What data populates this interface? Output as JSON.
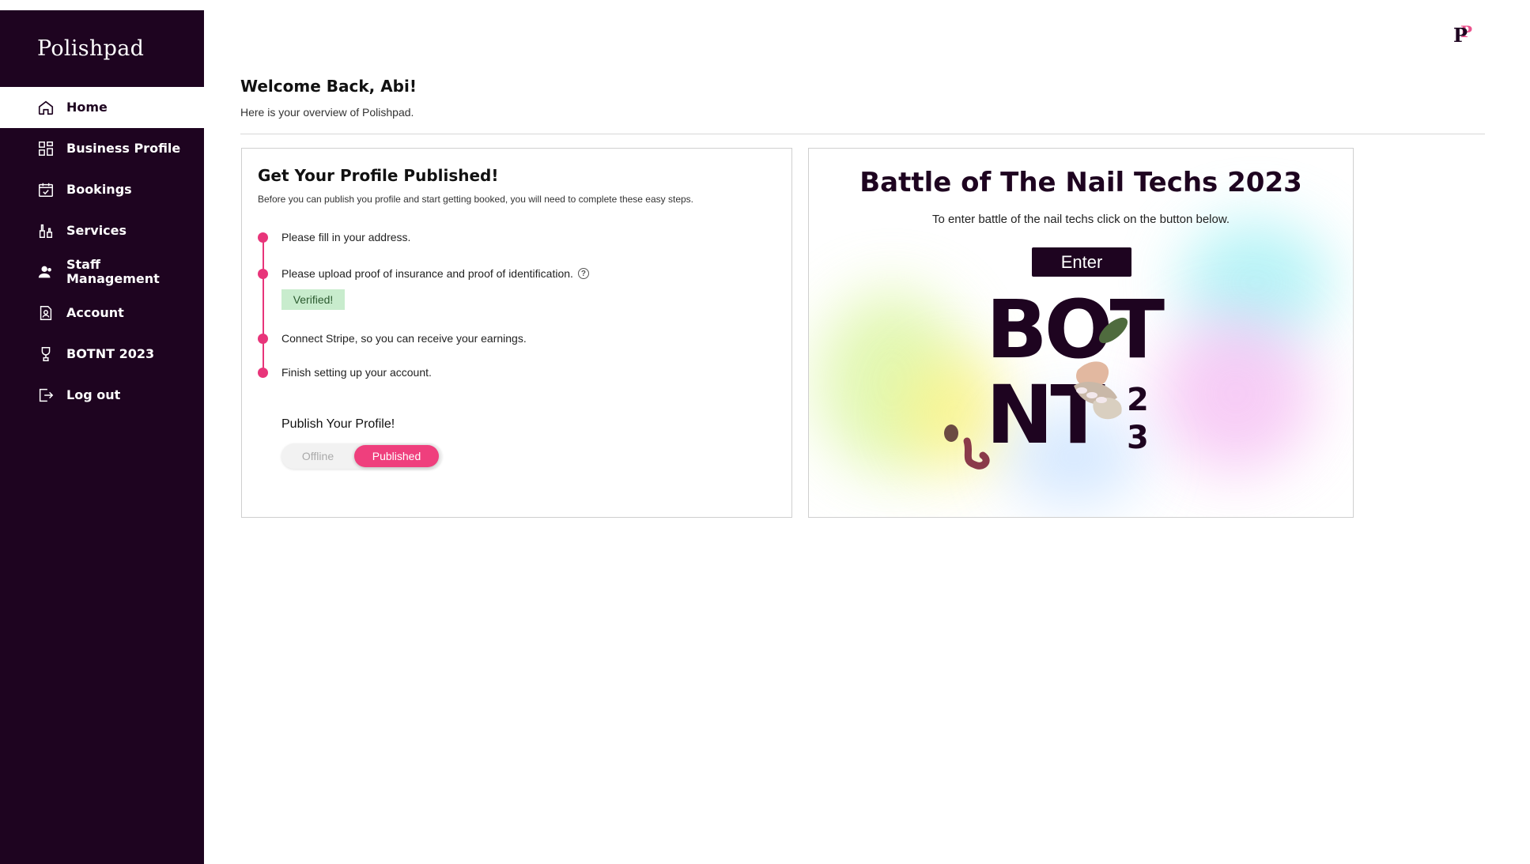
{
  "app": {
    "brand": "Polishpad"
  },
  "sidebar": {
    "items": [
      {
        "label": "Home",
        "icon": "home-icon",
        "active": true
      },
      {
        "label": "Business Profile",
        "icon": "grid-icon",
        "active": false
      },
      {
        "label": "Bookings",
        "icon": "calendar-check-icon",
        "active": false
      },
      {
        "label": "Services",
        "icon": "polish-bottles-icon",
        "active": false
      },
      {
        "label": "Staff\nManagement",
        "icon": "users-icon",
        "active": false
      },
      {
        "label": "Account",
        "icon": "account-document-icon",
        "active": false
      },
      {
        "label": "BOTNT 2023",
        "icon": "trophy-icon",
        "active": false
      },
      {
        "label": "Log out",
        "icon": "logout-icon",
        "active": false
      }
    ]
  },
  "header": {
    "welcome": "Welcome Back, Abi!",
    "subtitle": "Here is your overview of Polishpad."
  },
  "profile_card": {
    "title": "Get Your Profile Published!",
    "description": "Before you can publish you profile and start getting booked, you will need to complete these easy steps.",
    "steps": [
      "Please fill in your address.",
      "Please upload proof of insurance and proof of identification.",
      "Connect Stripe, so you can receive your earnings.",
      "Finish setting up your account."
    ],
    "verified_badge": "Verified!",
    "publish_label": "Publish Your Profile!",
    "toggle": {
      "off_label": "Offline",
      "on_label": "Published",
      "selected": "Published"
    }
  },
  "botnt_card": {
    "title": "Battle of The Nail Techs 2023",
    "description": "To enter battle of the nail techs click on the button below.",
    "enter_label": "Enter",
    "graphic": {
      "line1": "BOT",
      "line2": "NT",
      "num_top": "2",
      "num_bottom": "3"
    }
  },
  "colors": {
    "sidebar_bg": "#1e0420",
    "accent_pink": "#e8357a",
    "verified_bg": "#c8eccd"
  }
}
